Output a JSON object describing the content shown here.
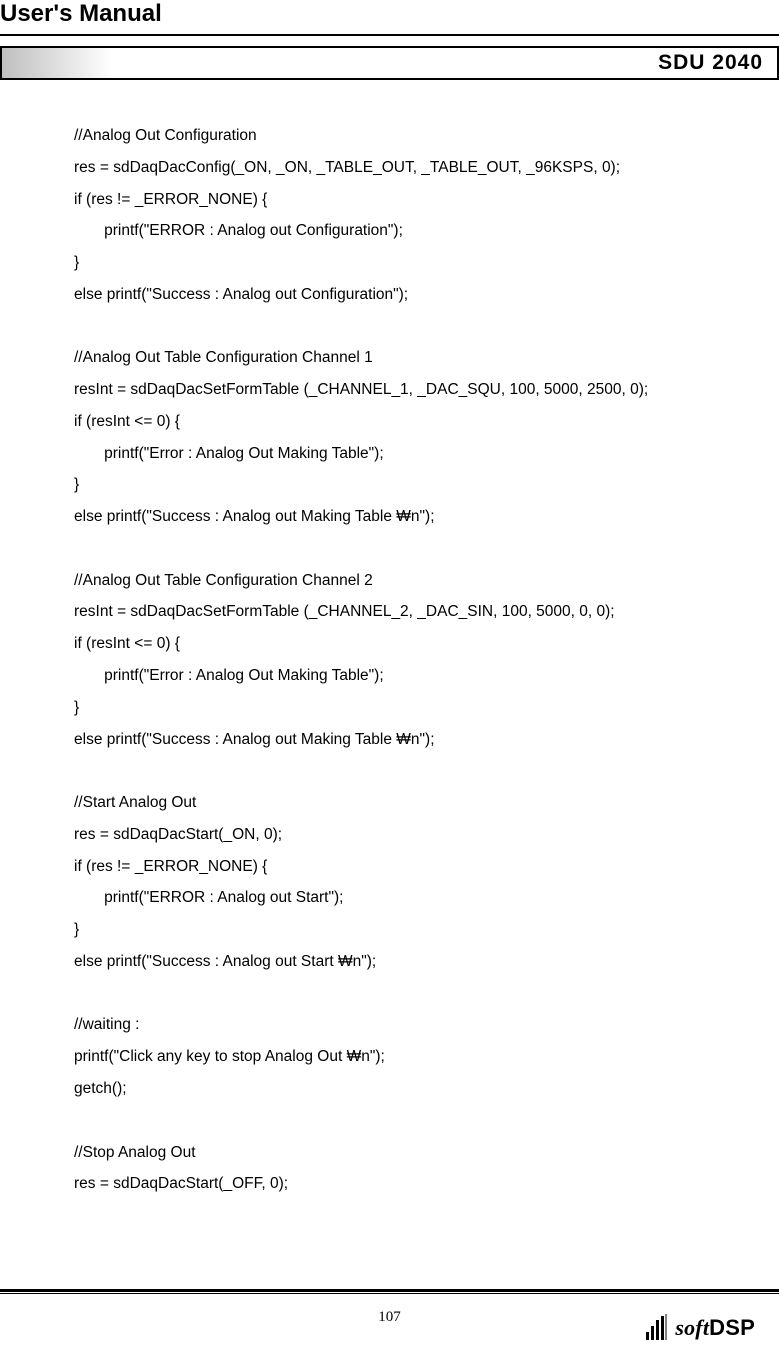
{
  "header": {
    "title": "User's Manual",
    "product": "SDU 2040"
  },
  "code": "//Analog Out Configuration\nres = sdDaqDacConfig(_ON, _ON, _TABLE_OUT, _TABLE_OUT, _96KSPS, 0);\nif (res != _ERROR_NONE) {\n       printf(\"ERROR : Analog out Configuration\");\n}\nelse printf(\"Success : Analog out Configuration\");\n\n//Analog Out Table Configuration Channel 1\nresInt = sdDaqDacSetFormTable (_CHANNEL_1, _DAC_SQU, 100, 5000, 2500, 0);\nif (resInt <= 0) {\n       printf(\"Error : Analog Out Making Table\");\n}\nelse printf(\"Success : Analog out Making Table ₩n\");\n\n//Analog Out Table Configuration Channel 2\nresInt = sdDaqDacSetFormTable (_CHANNEL_2, _DAC_SIN, 100, 5000, 0, 0);\nif (resInt <= 0) {\n       printf(\"Error : Analog Out Making Table\");\n}\nelse printf(\"Success : Analog out Making Table ₩n\");\n\n//Start Analog Out\nres = sdDaqDacStart(_ON, 0);\nif (res != _ERROR_NONE) {\n       printf(\"ERROR : Analog out Start\");\n}\nelse printf(\"Success : Analog out Start ₩n\");\n\n//waiting :\nprintf(\"Click any key to stop Analog Out ₩n\");\ngetch();\n\n//Stop Analog Out\nres = sdDaqDacStart(_OFF, 0);",
  "footer": {
    "page_number": "107",
    "logo_text_soft": "soft",
    "logo_text_dsp": "DSP"
  }
}
